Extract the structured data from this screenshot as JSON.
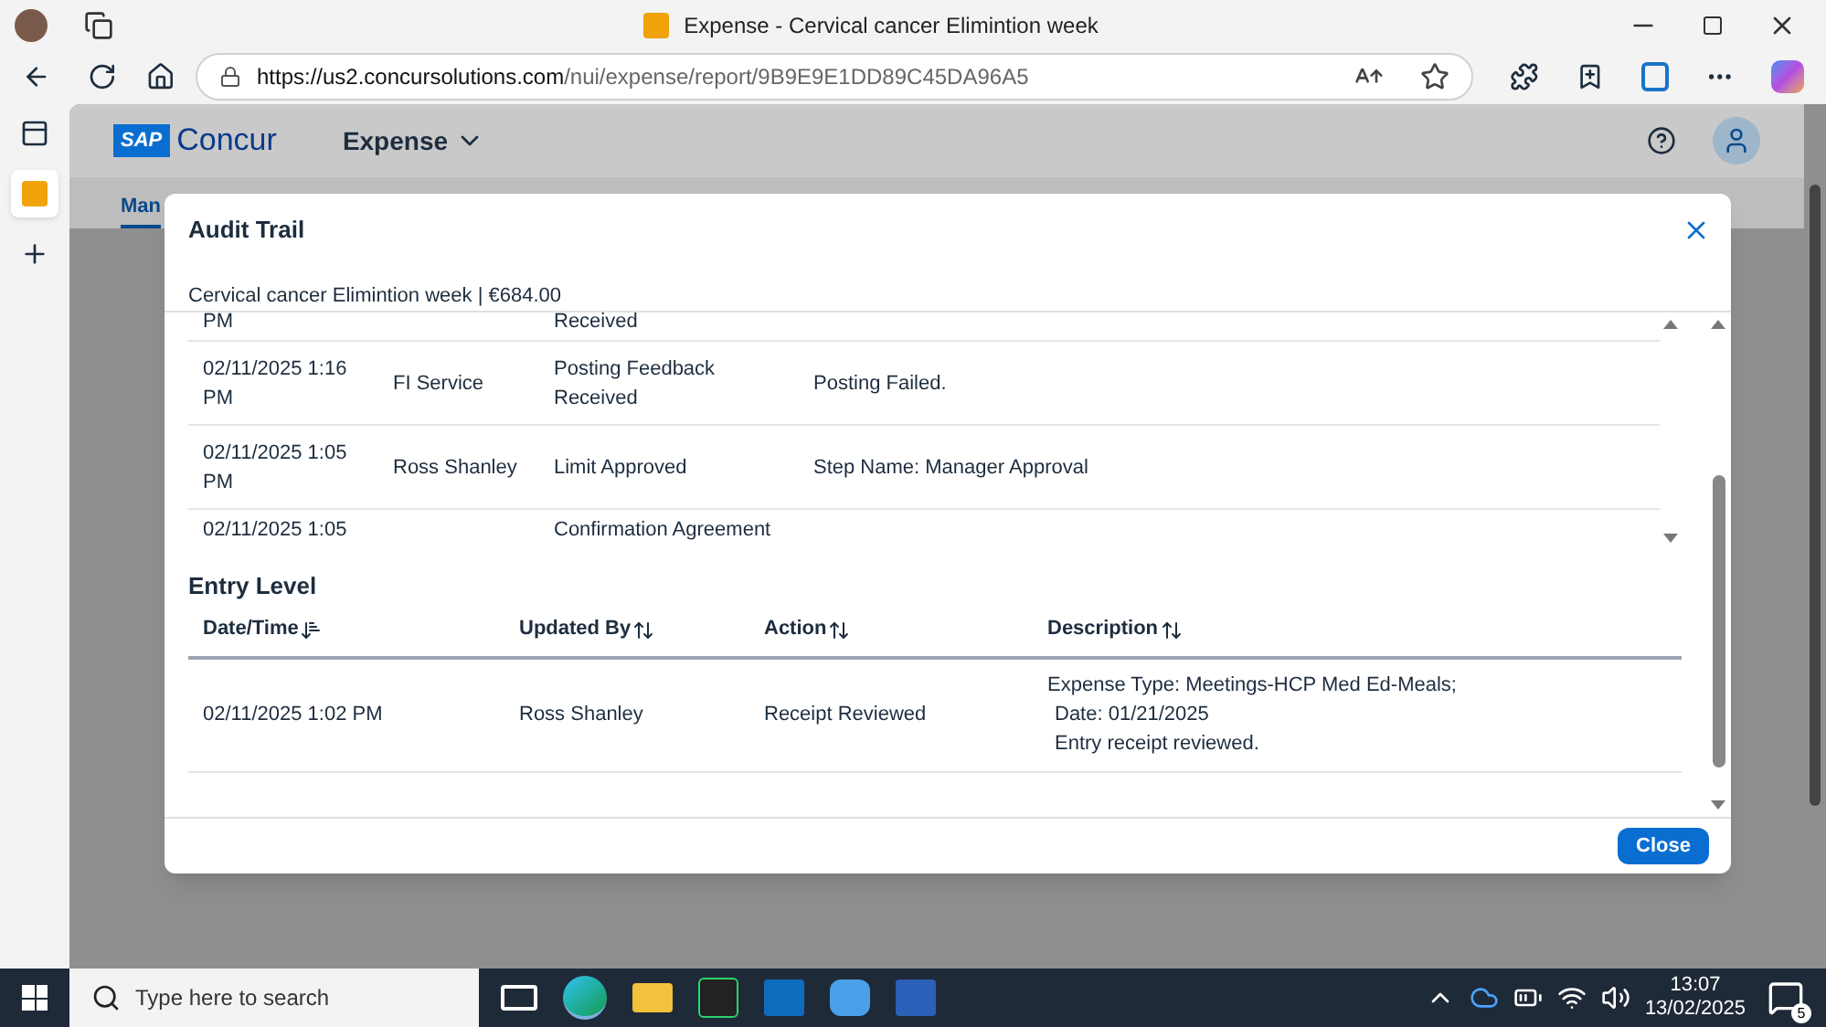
{
  "browser": {
    "tab_title": "Expense - Cervical cancer Elimintion week",
    "url_host": "https://us2.concursolutions.com",
    "url_path": "/nui/expense/report/9B9E9E1DD89C45DA96A5"
  },
  "app": {
    "logo_sap": "SAP",
    "logo_name": "Concur",
    "module": "Expense",
    "tabs": [
      {
        "label": "Man",
        "selected": true
      }
    ]
  },
  "dialog": {
    "title": "Audit Trail",
    "subtitle": "Cervical cancer Elimintion week | €684.00",
    "report_rows": [
      {
        "date": "PM",
        "action": "Received"
      },
      {
        "date": "02/11/2025 1:16 PM",
        "updated_by": "FI Service",
        "action": "Posting Feedback Received",
        "description": "Posting Failed."
      },
      {
        "date": "02/11/2025 1:05 PM",
        "updated_by": "Ross Shanley",
        "action": "Limit Approved",
        "description": "Step Name: Manager Approval"
      },
      {
        "date": "02/11/2025 1:05",
        "action": "Confirmation Agreement"
      }
    ],
    "entry_level": {
      "title": "Entry Level",
      "columns": [
        {
          "label": "Date/Time",
          "sorted": true
        },
        {
          "label": "Updated By",
          "sorted": false
        },
        {
          "label": "Action",
          "sorted": false
        },
        {
          "label": "Description",
          "sorted": false
        }
      ],
      "rows": [
        {
          "date": "02/11/2025 1:02 PM",
          "updated_by": "Ross Shanley",
          "action": "Receipt Reviewed",
          "description": [
            "Expense Type: Meetings-HCP Med Ed-Meals;",
            "Date: 01/21/2025",
            "Entry receipt reviewed."
          ]
        }
      ]
    },
    "close_button": "Close"
  },
  "taskbar": {
    "search_placeholder": "Type here to search",
    "time": "13:07",
    "date": "13/02/2025",
    "notifications": "5"
  }
}
